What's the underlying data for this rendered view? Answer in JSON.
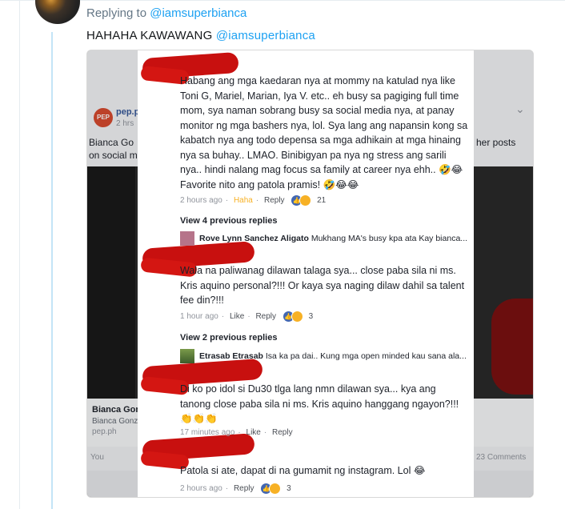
{
  "reply_header": {
    "prefix": "Replying to",
    "handle": "@iamsuperbianca"
  },
  "tweet": {
    "text": "HAHAHA KAWAWANG",
    "mention": "@iamsuperbianca"
  },
  "background_post": {
    "page_name": "pep.p",
    "time": "2 hrs",
    "text_line1": "Bianca Go",
    "text_line2": "on social m",
    "text_right": "her posts",
    "caption_title": "Bianca Gon",
    "caption_sub": "Bianca Gonz",
    "caption_domain": "pep.ph",
    "reactions_left": "You",
    "reactions_right": "23 Comments"
  },
  "comments": [
    {
      "text": "Habang ang mga kaedaran nya at mommy na katulad nya like Toni G, Mariel, Marian, Iya V. etc.. eh busy sa pagiging full time mom, sya naman sobrang busy sa social media nya, at panay monitor ng mga bashers nya, lol. Sya lang ang napansin kong sa kabatch nya ang todo depensa sa mga adhikain at mga hinaing nya sa buhay.. LMAO. Binibigyan pa nya ng stress ang sarili nya.. hindi nalang mag focus sa family at career nya ehh.. 🤣😂 Favorite nito ang patola pramis! 🤣😂😂",
      "time": "2 hours ago",
      "reaction": "Haha",
      "reply": "Reply",
      "count": "21"
    },
    {
      "text": "Wala na paliwanag dilawan talaga sya... close paba sila ni ms. Kris aquino personal?!!! Or kaya sya naging dilaw dahil sa talent fee din?!!!",
      "time": "1 hour ago",
      "reaction": "Like",
      "reply": "Reply",
      "count": "3"
    },
    {
      "text": "Di ko po idol si Du30 tlga lang nmn dilawan sya... kya ang tanong close paba sila ni ms. Kris aquino hanggang ngayon?!!! 👏👏👏",
      "time": "17 minutes ago",
      "reaction": "Like",
      "reply": "Reply"
    },
    {
      "text": "Patola si ate, dapat di na gumamit ng instagram. Lol 😂",
      "time": "2 hours ago",
      "reaction": "Reply",
      "reply": "",
      "count": "3"
    }
  ],
  "reply_groups": [
    {
      "view_label": "View 4 previous replies",
      "name": "Rove Lynn Sanchez Aligato",
      "snippet": "Mukhang MA's busy kpa ata Kay bianca..."
    },
    {
      "view_label": "View 2 previous replies",
      "name": "Etrasab Etrasab",
      "snippet": "Isa ka pa dai.. Kung mga open minded kau sana ala..."
    }
  ],
  "colors": {
    "link": "#1da1f2",
    "thread": "#c4e4f7",
    "scribble": "#c8100f",
    "haha": "#f7b125",
    "fb_blue": "#4267b2"
  }
}
